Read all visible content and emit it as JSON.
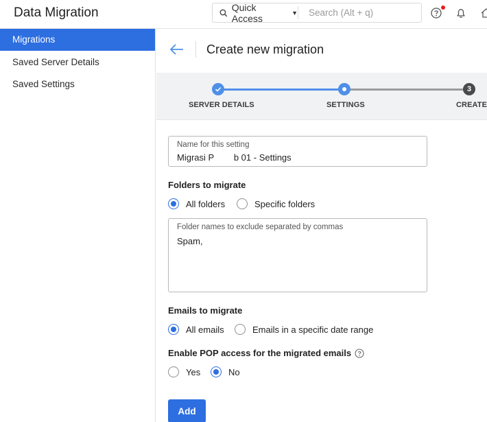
{
  "app": {
    "title": "Data Migration"
  },
  "header": {
    "quick_access_label": "Quick Access",
    "search_placeholder": "Search (Alt + q)",
    "icons": [
      "search-icon",
      "help-icon",
      "bell-icon",
      "home-icon"
    ],
    "notification_dot_color": "#e81d1d"
  },
  "sidebar": {
    "items": [
      {
        "label": "Migrations",
        "active": true
      },
      {
        "label": "Saved Server Details",
        "active": false
      },
      {
        "label": "Saved Settings",
        "active": false
      }
    ]
  },
  "main": {
    "title": "Create new migration",
    "steps": [
      {
        "label": "SERVER DETAILS",
        "state": "done"
      },
      {
        "label": "SETTINGS",
        "state": "current"
      },
      {
        "label": "CREATE",
        "state": "pending",
        "number": "3"
      }
    ],
    "setting_name": {
      "label": "Name for this setting",
      "value": "Migrasi P        b 01 - Settings"
    },
    "folders": {
      "title": "Folders to migrate",
      "options": [
        {
          "label": "All folders",
          "checked": true
        },
        {
          "label": "Specific folders",
          "checked": false
        }
      ],
      "exclude": {
        "label": "Folder names to exclude separated by commas",
        "value": "Spam,"
      }
    },
    "emails": {
      "title": "Emails to migrate",
      "options": [
        {
          "label": "All emails",
          "checked": true
        },
        {
          "label": "Emails in a specific date range",
          "checked": false
        }
      ]
    },
    "pop": {
      "title": "Enable POP access for the migrated emails",
      "options": [
        {
          "label": "Yes",
          "checked": false
        },
        {
          "label": "No",
          "checked": true
        }
      ]
    },
    "add_label": "Add"
  },
  "colors": {
    "accent": "#2d6ee0",
    "step_active": "#4f8fe8",
    "step_pending": "#4a4a4a"
  }
}
